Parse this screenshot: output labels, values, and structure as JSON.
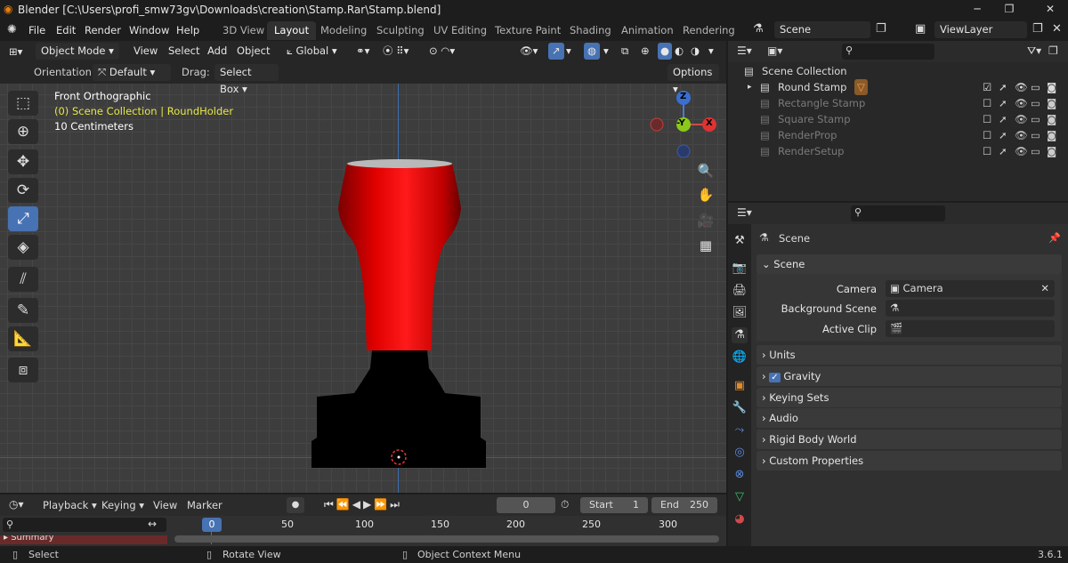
{
  "titlebar": {
    "title": "Blender [C:\\Users\\profi_smw73gv\\Downloads\\creation\\Stamp.Rar\\Stamp.blend]",
    "minimize": "─",
    "maximize": "❐",
    "close": "✕"
  },
  "menu": {
    "file": "File",
    "edit": "Edit",
    "render": "Render",
    "window": "Window",
    "help": "Help"
  },
  "workspaces": [
    "3D View",
    "Layout",
    "Modeling",
    "Sculpting",
    "UV Editing",
    "Texture Paint",
    "Shading",
    "Animation",
    "Rendering"
  ],
  "scene_field": "Scene",
  "viewlayer_field": "ViewLayer",
  "viewport_header": {
    "mode": "Object Mode",
    "view": "View",
    "select": "Select",
    "add": "Add",
    "object": "Object",
    "orientation_global": "Global"
  },
  "tool_settings": {
    "orientation_label": "Orientation:",
    "orientation_value": "Default",
    "drag_label": "Drag:",
    "drag_value": "Select Box",
    "options": "Options"
  },
  "overlay": {
    "view_name": "Front Orthographic",
    "collection": "(0) Scene Collection | RoundHolder",
    "scale": "10 Centimeters"
  },
  "gizmo": {
    "z": "Z",
    "y": "-Y",
    "x": "X"
  },
  "outliner": {
    "root": "Scene Collection",
    "items": [
      {
        "label": "Round Stamp",
        "checked": true,
        "active": true
      },
      {
        "label": "Rectangle Stamp",
        "checked": false,
        "active": false
      },
      {
        "label": "Square Stamp",
        "checked": false,
        "active": false
      },
      {
        "label": "RenderProp",
        "checked": false,
        "active": false
      },
      {
        "label": "RenderSetup",
        "checked": false,
        "active": false
      }
    ]
  },
  "properties": {
    "header": "Scene",
    "panel_scene": "Scene",
    "camera_label": "Camera",
    "camera_value": "Camera",
    "bg_label": "Background Scene",
    "clip_label": "Active Clip",
    "panels": [
      "Units",
      "Gravity",
      "Keying Sets",
      "Audio",
      "Rigid Body World",
      "Custom Properties"
    ]
  },
  "timeline": {
    "playback": "Playback",
    "keying": "Keying",
    "view": "View",
    "marker": "Marker",
    "current": "0",
    "start_label": "Start",
    "start": "1",
    "end_label": "End",
    "end": "250",
    "ticks": [
      "0",
      "50",
      "100",
      "150",
      "200",
      "250",
      "300"
    ],
    "summary": "Summary"
  },
  "status": {
    "select": "Select",
    "rotate": "Rotate View",
    "context": "Object Context Menu",
    "version": "3.6.1"
  },
  "colors": {
    "accent": "#4772b3",
    "red_handle": "#dd0000",
    "stamp_base": "#000000"
  }
}
